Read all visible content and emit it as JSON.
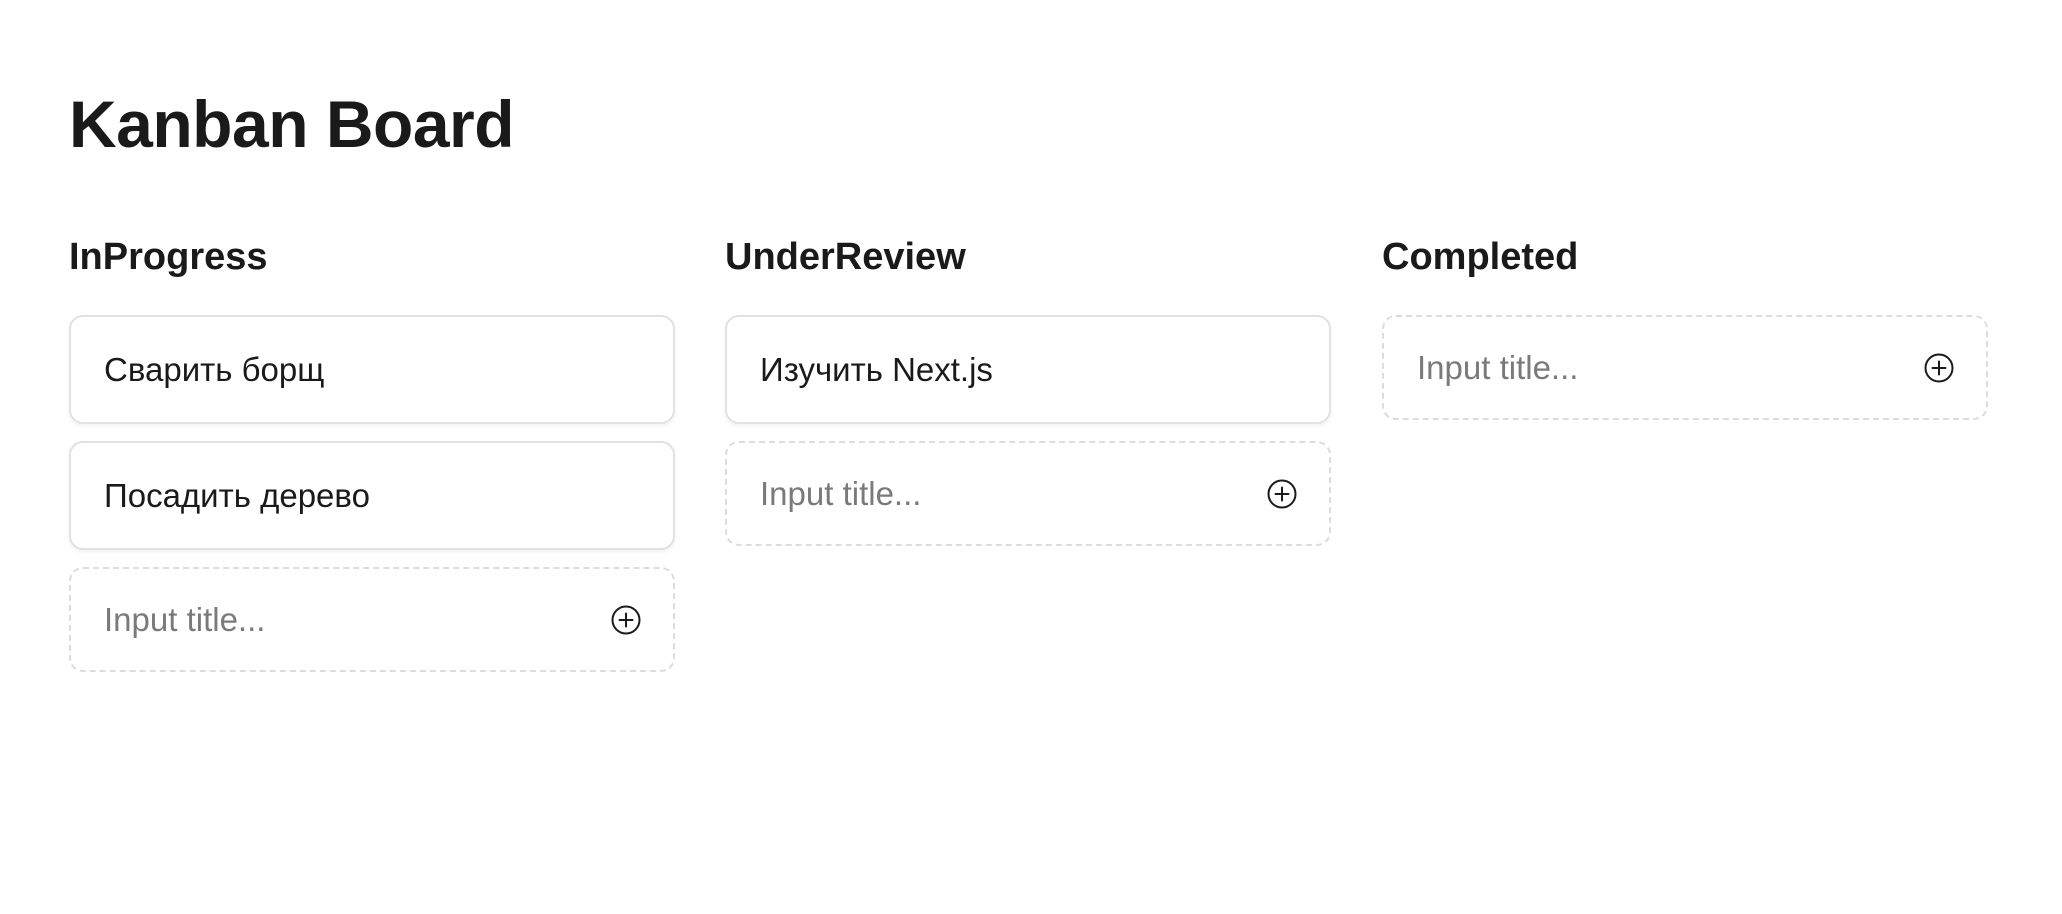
{
  "page": {
    "title": "Kanban Board"
  },
  "columns": [
    {
      "title": "InProgress",
      "cards": [
        "Сварить борщ",
        "Посадить дерево"
      ],
      "input": {
        "value": "",
        "placeholder": "Input title..."
      },
      "add_icon": "plus-circle-icon"
    },
    {
      "title": "UnderReview",
      "cards": [
        "Изучить Next.js"
      ],
      "input": {
        "value": "",
        "placeholder": "Input title..."
      },
      "add_icon": "plus-circle-icon"
    },
    {
      "title": "Completed",
      "cards": [],
      "input": {
        "value": "",
        "placeholder": "Input title..."
      },
      "add_icon": "plus-circle-icon"
    }
  ],
  "colors": {
    "text": "#1a1a1a",
    "card_border": "#e2e2e2",
    "dashed_border": "#dcdcdc",
    "placeholder": "#7a7a7a",
    "background": "#ffffff"
  }
}
